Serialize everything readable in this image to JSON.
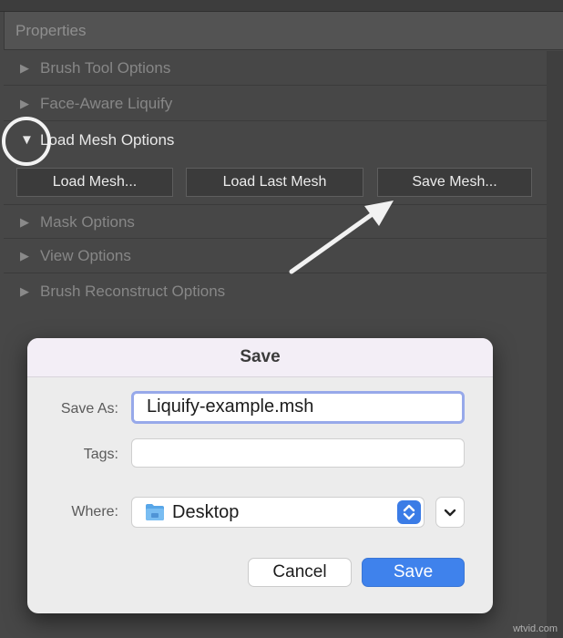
{
  "panel": {
    "title": "Properties",
    "sections": [
      {
        "label": "Brush Tool Options",
        "expanded": false
      },
      {
        "label": "Face-Aware Liquify",
        "expanded": false
      },
      {
        "label": "Load Mesh Options",
        "expanded": true
      },
      {
        "label": "Mask Options",
        "expanded": false
      },
      {
        "label": "View Options",
        "expanded": false
      },
      {
        "label": "Brush Reconstruct Options",
        "expanded": false
      }
    ],
    "mesh_buttons": {
      "load_mesh": "Load Mesh...",
      "load_last_mesh": "Load Last Mesh",
      "save_mesh": "Save Mesh..."
    },
    "icons": {
      "collapsed": "triangle-right-icon",
      "expanded": "triangle-down-icon"
    }
  },
  "dialog": {
    "title": "Save",
    "save_as_label": "Save As:",
    "save_as_value": "Liquify-example.msh",
    "tags_label": "Tags:",
    "tags_value": "",
    "where_label": "Where:",
    "where_value": "Desktop",
    "cancel_label": "Cancel",
    "save_label": "Save"
  },
  "watermark": "wtvid.com",
  "colors": {
    "accent": "#3f82ec",
    "focus_ring": "#97a9ea",
    "panel": "#474747"
  }
}
